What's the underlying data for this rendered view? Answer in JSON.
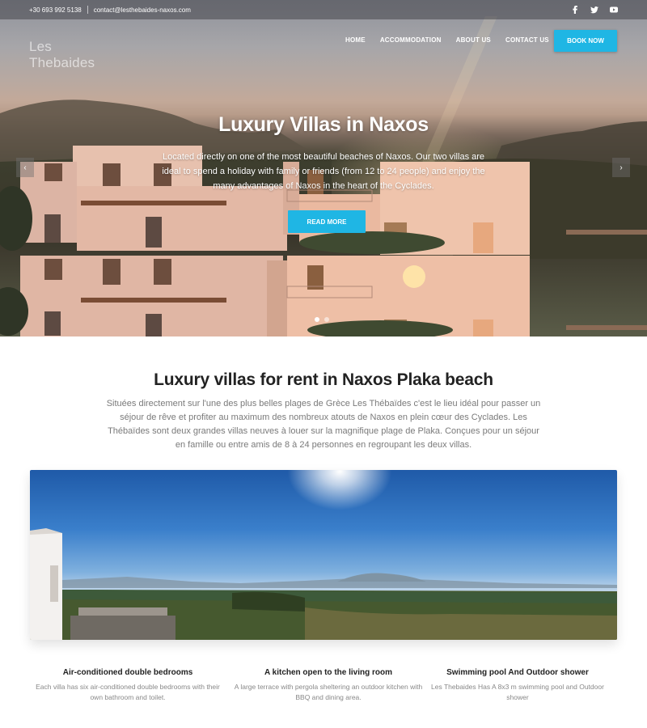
{
  "topbar": {
    "phone": "+30 693 992 5138",
    "email": "contact@lesthebaides-naxos.com",
    "social": [
      "facebook-icon",
      "twitter-icon",
      "youtube-icon"
    ]
  },
  "logo": {
    "text": "Les Thebaides"
  },
  "nav": {
    "items": [
      "HOME",
      "ACCOMMODATION",
      "ABOUT US",
      "CONTACT US"
    ],
    "book_label": "BOOK NOW"
  },
  "hero": {
    "title": "Luxury Villas in Naxos",
    "text": "Located directly on one of the most beautiful beaches of Naxos. Our two villas are ideal to spend a holiday with family or friends (from 12 to 24 people) and enjoy the many advantages of Naxos in the heart of the Cyclades.",
    "button": "READ MORE",
    "prev_arrow": "‹",
    "next_arrow": "›",
    "slides_count": 2,
    "active_slide": 1
  },
  "main": {
    "title": "Luxury villas for rent in Naxos Plaka beach",
    "text": "Situées directement sur l'une des plus belles plages de Grèce Les Thébaïdes c'est le lieu idéal pour passer un séjour de rêve et profiter au maximum des nombreux atouts de Naxos en plein cœur des Cyclades. Les Thébaïdes sont deux grandes villas neuves à louer sur la magnifique plage de Plaka. Conçues pour un séjour en famille ou entre amis de 8 à 24 personnes en regroupant les deux villas."
  },
  "features": [
    {
      "title": "Air-conditioned double bedrooms",
      "text": "Each villa has six air-conditioned double bedrooms with their own bathroom and toilet."
    },
    {
      "title": "A kitchen open to the living room",
      "text": "A large terrace with pergola sheltering an outdoor kitchen with BBQ and dining area."
    },
    {
      "title": "Swimming pool And Outdoor shower",
      "text": "Les Thebaides Has A 8x3 m swimming pool and Outdoor shower"
    }
  ],
  "colors": {
    "accent": "#1fb6e4",
    "heading": "#222222",
    "body_text": "#7a7a7a"
  }
}
